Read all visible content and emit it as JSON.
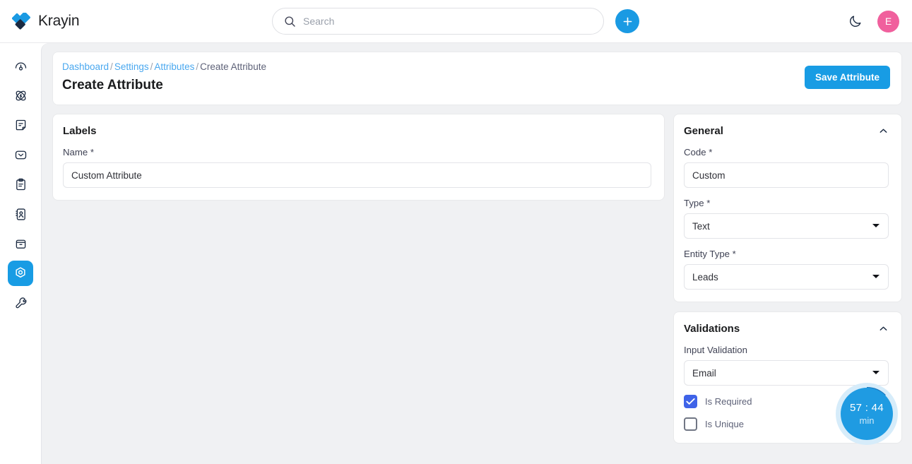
{
  "brand": {
    "name": "Krayin",
    "logo_icon": "krayin-diamond-logo"
  },
  "header": {
    "search": {
      "placeholder": "Search",
      "value": "",
      "icon": "search-icon"
    },
    "add_button": {
      "icon": "plus-icon",
      "label": "+"
    },
    "theme_toggle": {
      "icon": "moon-icon"
    },
    "avatar": {
      "initial": "E",
      "color": "#f0609d"
    }
  },
  "sidebar": {
    "items": [
      {
        "name": "dashboard",
        "icon": "gauge-icon",
        "active": false
      },
      {
        "name": "leads",
        "icon": "atom-icon",
        "active": false
      },
      {
        "name": "quotes",
        "icon": "note-document-icon",
        "active": false
      },
      {
        "name": "mail",
        "icon": "envelope-icon",
        "active": false
      },
      {
        "name": "activities",
        "icon": "clipboard-icon",
        "active": false
      },
      {
        "name": "contacts",
        "icon": "address-book-icon",
        "active": false
      },
      {
        "name": "products",
        "icon": "box-archive-icon",
        "active": false
      },
      {
        "name": "settings",
        "icon": "hex-nut-icon",
        "active": true
      },
      {
        "name": "configuration",
        "icon": "wrench-icon",
        "active": false
      }
    ]
  },
  "page": {
    "breadcrumb": [
      {
        "label": "Dashboard",
        "link": true
      },
      {
        "label": "Settings",
        "link": true
      },
      {
        "label": "Attributes",
        "link": true
      },
      {
        "label": "Create Attribute",
        "link": false
      }
    ],
    "breadcrumb_separator": "/",
    "title": "Create Attribute",
    "save_button": "Save Attribute"
  },
  "labels_panel": {
    "title": "Labels",
    "name_field": {
      "label": "Name *",
      "value": "Custom Attribute",
      "placeholder": ""
    }
  },
  "general_panel": {
    "title": "General",
    "collapse_icon": "chevron-up-icon",
    "code_field": {
      "label": "Code *",
      "value": "Custom",
      "placeholder": ""
    },
    "type_field": {
      "label": "Type *",
      "value": "Text",
      "caret_icon": "chevron-down-icon"
    },
    "entity_type_field": {
      "label": "Entity Type *",
      "value": "Leads",
      "caret_icon": "chevron-down-icon"
    }
  },
  "validations_panel": {
    "title": "Validations",
    "collapse_icon": "chevron-up-icon",
    "input_validation": {
      "label": "Input Validation",
      "value": "Email",
      "caret_icon": "chevron-down-icon"
    },
    "checkboxes": [
      {
        "label": "Is Required",
        "checked": true
      },
      {
        "label": "Is Unique",
        "checked": false
      }
    ]
  },
  "timer_widget": {
    "time": "57 : 44",
    "unit": "min",
    "color": "#1f9be2"
  }
}
